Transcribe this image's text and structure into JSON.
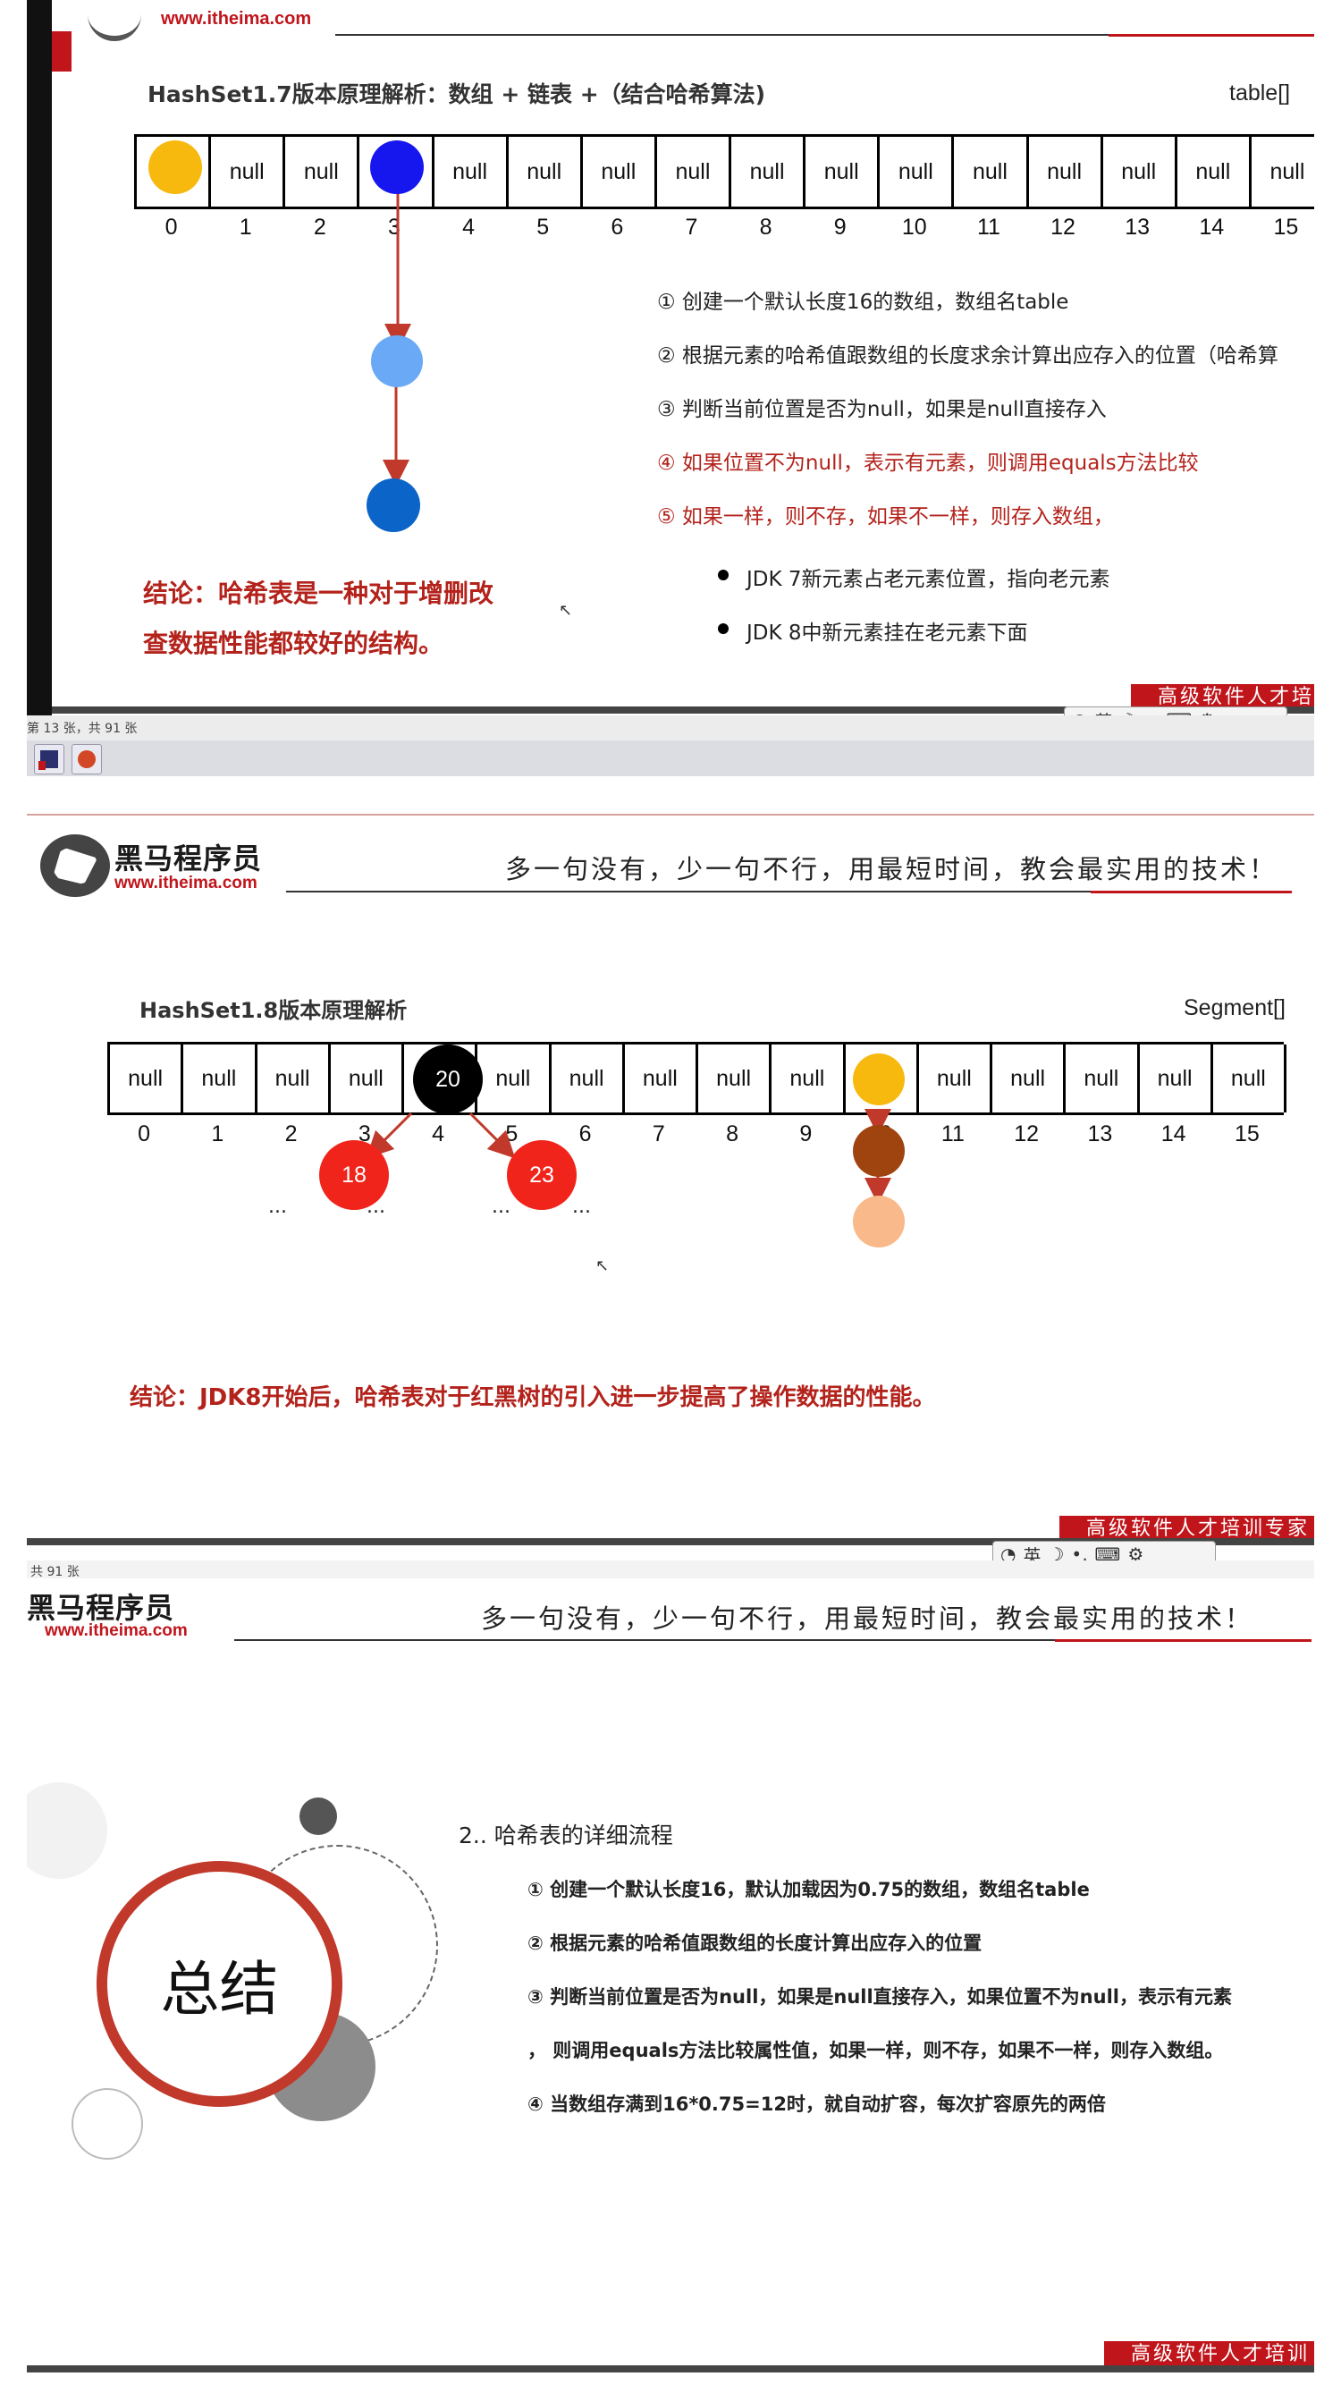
{
  "slide1": {
    "brand_url": "www.itheima.com",
    "title": "HashSet1.7版本原理解析：数组 + 链表 +（结合哈希算法)",
    "array_name": "table[]",
    "cells": [
      "",
      "null",
      "null",
      "",
      "null",
      "null",
      "null",
      "null",
      "null",
      "null",
      "null",
      "null",
      "null",
      "null",
      "null",
      "null"
    ],
    "indices": [
      "0",
      "1",
      "2",
      "3",
      "4",
      "5",
      "6",
      "7",
      "8",
      "9",
      "10",
      "11",
      "12",
      "13",
      "14",
      "15"
    ],
    "steps": [
      {
        "text": "①  创建一个默认长度16的数组，数组名table",
        "color": "#222222"
      },
      {
        "text": "②  根据元素的哈希值跟数组的长度求余计算出应存入的位置（哈希算",
        "color": "#222222"
      },
      {
        "text": "③  判断当前位置是否为null，如果是null直接存入",
        "color": "#222222"
      },
      {
        "text": "④  如果位置不为null，表示有元素，则调用equals方法比较",
        "color": "#b3221b"
      },
      {
        "text": "⑤  如果一样，则不存，如果不一样，则存入数组，",
        "color": "#b3221b"
      }
    ],
    "bullets": [
      "JDK 7新元素占老元素位置，指向老元素",
      "JDK 8中新元素挂在老元素下面"
    ],
    "conclusion_line1": "结论：哈希表是一种对于增删改",
    "conclusion_line2": "查数据性能都较好的结构。",
    "ribbon": "高级软件人才培",
    "toolbar_lang": "英",
    "status": "第 13 张，共 91 张",
    "colors": {
      "yellow": "#f7b90e",
      "blue": "#1616ee",
      "lightblue": "#6aa9f5",
      "darkblue": "#0b64c8",
      "arrow": "#c0392b"
    }
  },
  "slide2": {
    "brand_name": "黑马程序员",
    "brand_url": "www.itheima.com",
    "slogan": "多一句没有，少一句不行，用最短时间，教会最实用的技术！",
    "title": "HashSet1.8版本原理解析",
    "array_name": "Segment[]",
    "cells": [
      "null",
      "null",
      "null",
      "null",
      "20",
      "null",
      "null",
      "null",
      "null",
      "null",
      "",
      "null",
      "null",
      "null",
      "null",
      "null"
    ],
    "indices": [
      "0",
      "1",
      "2",
      "3",
      "4",
      "5",
      "6",
      "7",
      "8",
      "9",
      "10",
      "11",
      "12",
      "13",
      "14",
      "15"
    ],
    "node_18": "18",
    "node_23": "23",
    "dots": "...",
    "conclusion": "结论：JDK8开始后，哈希表对于红黑树的引入进一步提高了操作数据的性能。",
    "ribbon": "高级软件人才培训专家",
    "toolbar_lang": "英",
    "status": "共 91 张",
    "colors": {
      "red": "#f0241b",
      "black": "#000000",
      "yellow": "#f7b90e",
      "brown": "#a0440f",
      "peach": "#f9b98a"
    }
  },
  "slide3": {
    "brand_name": "黑马程序员",
    "brand_url": "www.itheima.com",
    "slogan": "多一句没有，少一句不行，用最短时间，教会最实用的技术！",
    "summary_word": "总结",
    "heading": "2.. 哈希表的详细流程",
    "items": [
      "① 创建一个默认长度16，默认加载因为0.75的数组，数组名table",
      "② 根据元素的哈希值跟数组的长度计算出应存入的位置",
      "③ 判断当前位置是否为null，如果是null直接存入，如果位置不为null，表示有元素",
      "，  则调用equals方法比较属性值，如果一样，则不存，如果不一样，则存入数组。",
      "④ 当数组存满到16*0.75=12时，就自动扩容，每次扩容原先的两倍"
    ],
    "ribbon": "高级软件人才培训"
  }
}
